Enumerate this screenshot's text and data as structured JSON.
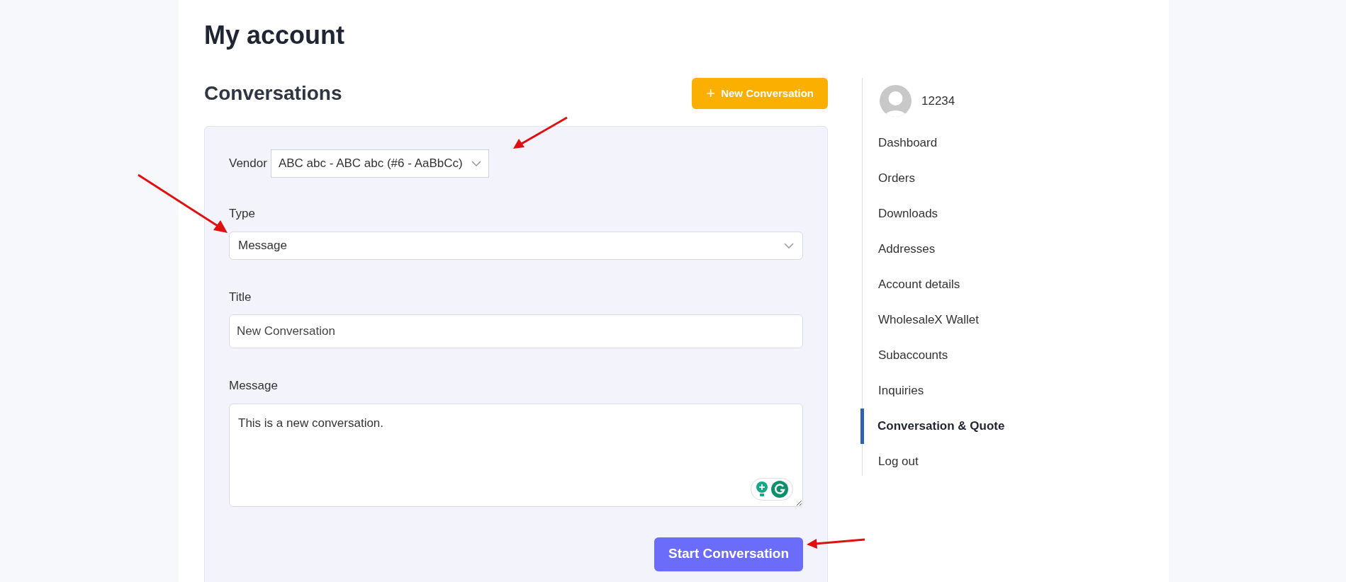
{
  "page_title": "My account",
  "section_title": "Conversations",
  "new_button": {
    "icon": "+",
    "label": "New Conversation"
  },
  "form": {
    "vendor": {
      "label": "Vendor",
      "value": "ABC abc - ABC abc (#6 - AaBbCc)"
    },
    "type": {
      "label": "Type",
      "value": "Message"
    },
    "title": {
      "label": "Title",
      "value": "New Conversation"
    },
    "message": {
      "label": "Message",
      "value": "This is a new conversation."
    },
    "submit": "Start Conversation"
  },
  "account": {
    "username": "12234"
  },
  "nav": [
    {
      "label": "Dashboard",
      "selected": false
    },
    {
      "label": "Orders",
      "selected": false
    },
    {
      "label": "Downloads",
      "selected": false
    },
    {
      "label": "Addresses",
      "selected": false
    },
    {
      "label": "Account details",
      "selected": false
    },
    {
      "label": "WholesaleX Wallet",
      "selected": false
    },
    {
      "label": "Subaccounts",
      "selected": false
    },
    {
      "label": "Inquiries",
      "selected": false
    },
    {
      "label": "Conversation & Quote",
      "selected": true
    },
    {
      "label": "Log out",
      "selected": false
    }
  ]
}
